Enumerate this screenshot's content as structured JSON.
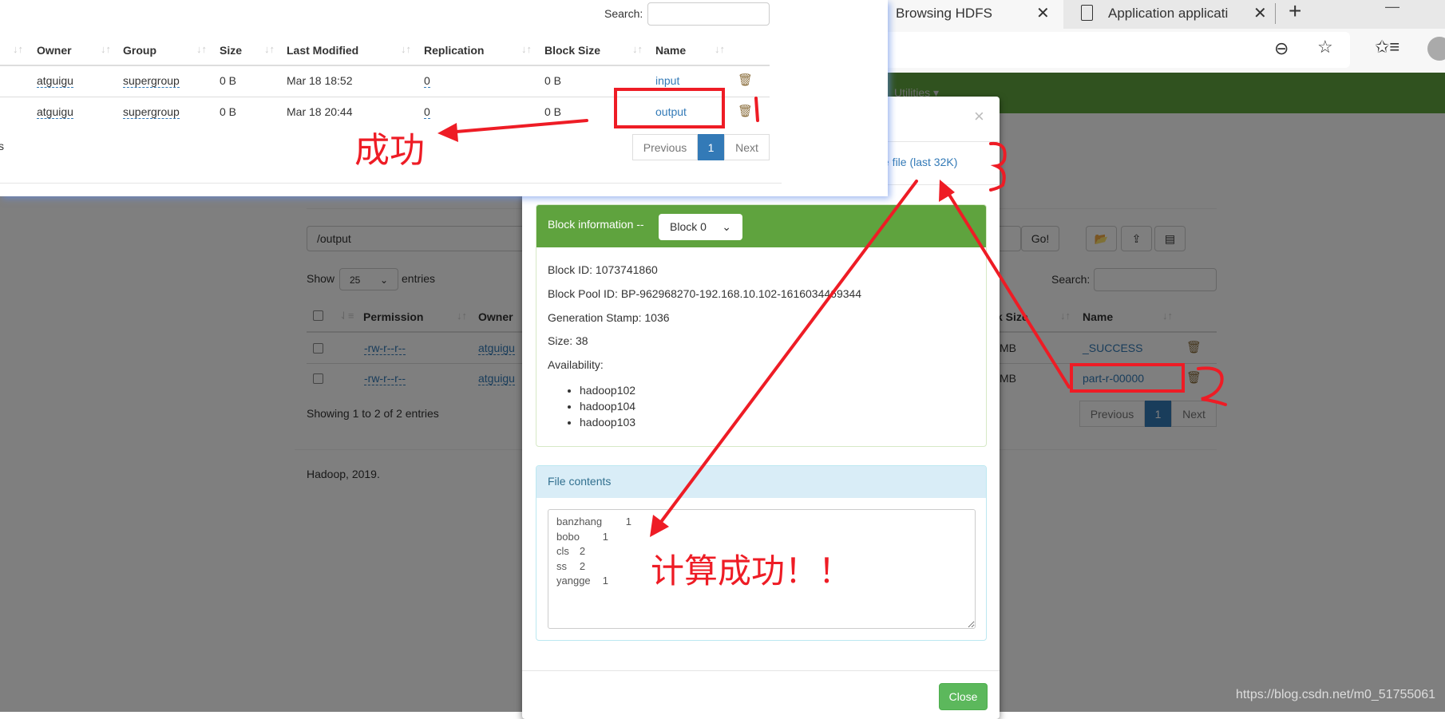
{
  "browser": {
    "tabs": [
      {
        "title": "Browsing HDFS",
        "active": true
      },
      {
        "title": "Application applicati",
        "icon": "document-icon"
      }
    ],
    "toolbar_icons": [
      "zoom-out-icon",
      "add-favorite-icon",
      "favorites-icon",
      "profile-avatar"
    ]
  },
  "page": {
    "navbar": {
      "utilities": "Utilities"
    },
    "path_value": "/output",
    "go_label": "Go!",
    "toolbar_icons": [
      "folder-open-icon",
      "upload-icon",
      "list-icon"
    ],
    "show_label": "Show",
    "entries_select": "25",
    "entries_label": "entries",
    "search_label": "Search:",
    "columns": [
      "Permission",
      "Owner",
      "k Size",
      "Name"
    ],
    "rows": [
      {
        "permission": "-rw-r--r--",
        "owner": "atguigu",
        "block_size": "MB",
        "name": "_SUCCESS"
      },
      {
        "permission": "-rw-r--r--",
        "owner": "atguigu",
        "block_size": "MB",
        "name": "part-r-00000"
      }
    ],
    "showing": "Showing 1 to 2 of 2 entries",
    "pagination": {
      "previous": "Previous",
      "current": "1",
      "next": "Next"
    },
    "footer": "Hadoop, 2019."
  },
  "modal": {
    "close_x": "×",
    "tail_link": "e file (last 32K)",
    "block_info": {
      "title": "Block information --",
      "selected_block": "Block 0",
      "block_id": "Block ID: 1073741860",
      "block_pool_id": "Block Pool ID: BP-962968270-192.168.10.102-1616034469344",
      "generation_stamp": "Generation Stamp: 1036",
      "size": "Size: 38",
      "availability_label": "Availability:",
      "availability": [
        "hadoop102",
        "hadoop104",
        "hadoop103"
      ]
    },
    "file_contents": {
      "title": "File contents",
      "text": "banzhang\t1\nbobo\t1\ncls\t2\nss\t2\nyangge\t1"
    },
    "close_label": "Close",
    "colors": {
      "block_header": "#5fa33e",
      "file_header": "#d9edf7",
      "close_button": "#5cb85c"
    }
  },
  "overlay_panel": {
    "search_label": "Search:",
    "columns": [
      "Owner",
      "Group",
      "Size",
      "Last Modified",
      "Replication",
      "Block Size",
      "Name"
    ],
    "rows": [
      {
        "owner": "atguigu",
        "group": "supergroup",
        "size": "0 B",
        "modified": "Mar 18 18:52",
        "replication": "0",
        "block_size": "0 B",
        "name": "input"
      },
      {
        "owner": "atguigu",
        "group": "supergroup",
        "size": "0 B",
        "modified": "Mar 18 20:44",
        "replication": "0",
        "block_size": "0 B",
        "name": "output"
      }
    ],
    "partial_text": "s",
    "pagination": {
      "previous": "Previous",
      "current": "1",
      "next": "Next"
    }
  },
  "annotations": {
    "success": "成功",
    "compute_success": "计算成功！！",
    "step_marks": [
      "1",
      "2",
      "3"
    ],
    "color": "#ee1c25"
  },
  "watermark": "https://blog.csdn.net/m0_51755061"
}
